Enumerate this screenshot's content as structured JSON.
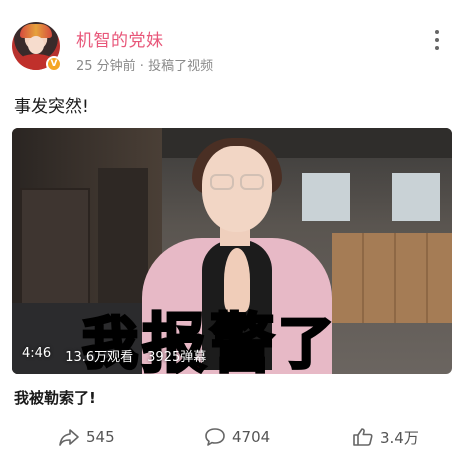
{
  "post": {
    "author": "机智的党妹",
    "meta": "25 分钟前 · 投稿了视频",
    "text": "事发突然!",
    "badge": "V"
  },
  "video": {
    "duration": "4:46",
    "views": "13.6万观看",
    "danmaku": "3925弹幕",
    "caption": [
      "我",
      "报",
      "警",
      "了"
    ],
    "title": "我被勒索了!"
  },
  "actions": {
    "share_count": "545",
    "comment_count": "4704",
    "like_count": "3.4万"
  },
  "icons": {
    "more": "more-vertical-icon",
    "share": "share-icon",
    "comment": "comment-icon",
    "like": "thumbs-up-icon"
  },
  "colors": {
    "author": "#e8577a",
    "meta": "#8a8a8a",
    "badge": "#f5a623"
  }
}
